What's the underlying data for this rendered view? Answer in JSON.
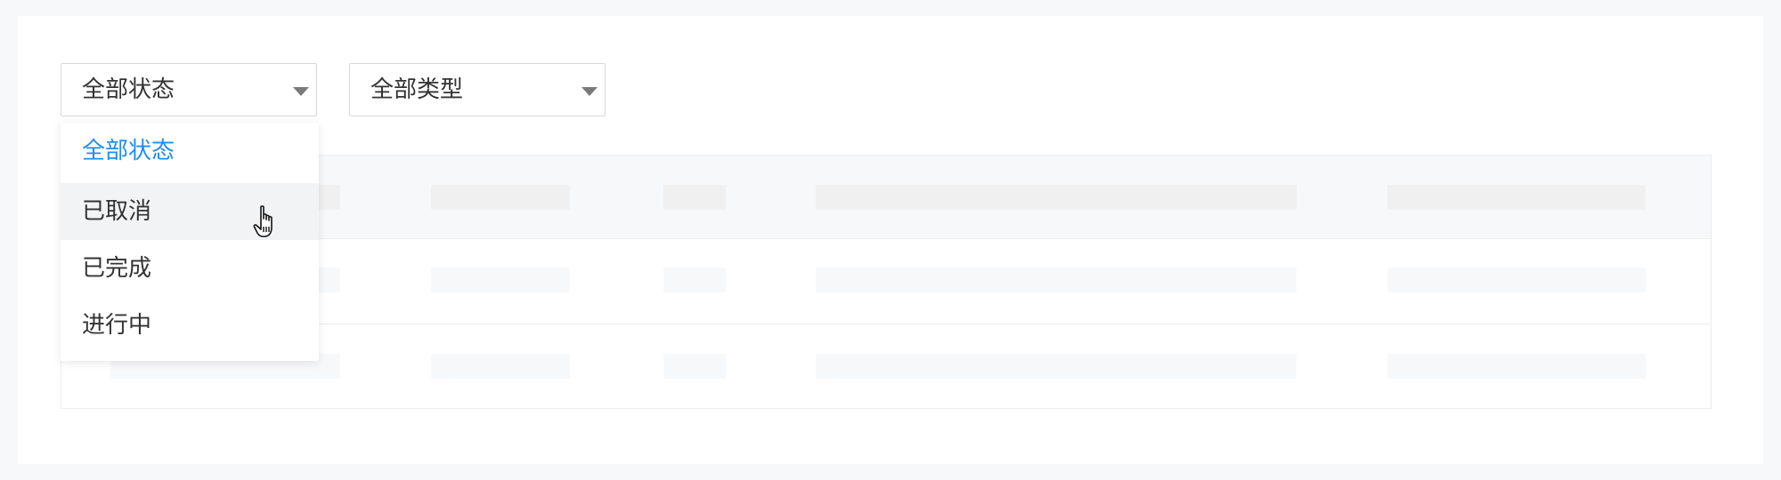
{
  "filters": {
    "status": {
      "selected": "全部状态",
      "options": [
        "全部状态",
        "已取消",
        "已完成",
        "进行中"
      ],
      "highlighted": "已取消",
      "dropdown_open": true
    },
    "type": {
      "selected": "全部类型"
    }
  },
  "table": {
    "state": "loading-skeleton",
    "rows": 2,
    "columns": 5
  },
  "colors": {
    "accent": "#1f8df2",
    "text": "#333333",
    "hover_bg": "#f2f3f5",
    "skeleton": "#f0f0f0"
  },
  "cursor": {
    "icon": "hand-pointer-icon"
  }
}
